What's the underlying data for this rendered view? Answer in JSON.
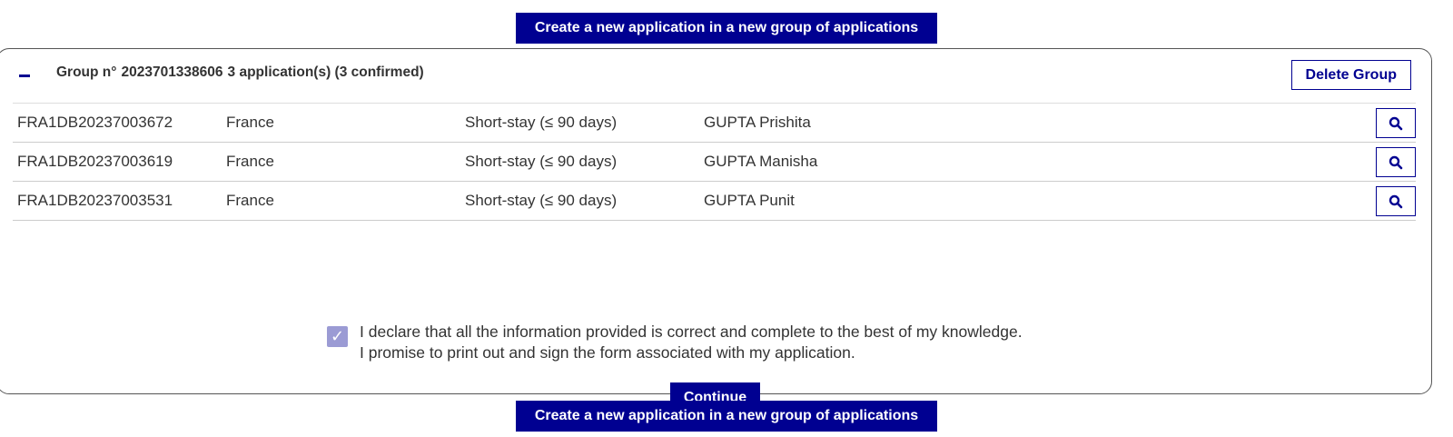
{
  "actions": {
    "new_group_label": "Create a new application in a new group of applications"
  },
  "group": {
    "title_prefix": "Group n°",
    "number": "2023701338606",
    "count_text": "3 application(s) (3 confirmed)",
    "delete_label": "Delete Group",
    "applications": [
      {
        "reference": "FRA1DB20237003672",
        "country": "France",
        "visa_type": "Short-stay (≤ 90 days)",
        "applicant": "GUPTA Prishita"
      },
      {
        "reference": "FRA1DB20237003619",
        "country": "France",
        "visa_type": "Short-stay (≤ 90 days)",
        "applicant": "GUPTA Manisha"
      },
      {
        "reference": "FRA1DB20237003531",
        "country": "France",
        "visa_type": "Short-stay (≤ 90 days)",
        "applicant": "GUPTA Punit"
      }
    ]
  },
  "declaration": {
    "checked": true,
    "line1": "I declare that all the information provided is correct and complete to the best of my knowledge.",
    "line2": "I promise to print out and sign the form associated with my application."
  },
  "continue_label": "Continue",
  "colors": {
    "primary": "#000091",
    "checkbox": "#9b9bd4"
  },
  "icons": {
    "view": "search-icon",
    "collapse": "minus-icon",
    "check": "check-icon"
  }
}
